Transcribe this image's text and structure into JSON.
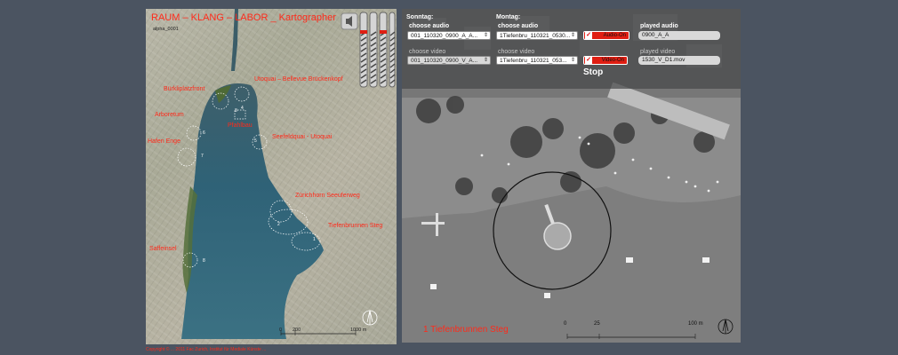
{
  "left": {
    "title": "RAUM – KLANG – LABOR _ Kartographer",
    "version": "alpha_0001",
    "places": [
      {
        "name": "Bürkliplatzfront"
      },
      {
        "name": "Utoquai – Bellevue Brückenkopf"
      },
      {
        "name": "Arboretum"
      },
      {
        "name": "Pfahlbau"
      },
      {
        "name": "Hafen Enge"
      },
      {
        "name": "Seefeldquai - Utoquai"
      },
      {
        "name": "Zürichhorn Seeuferweg"
      },
      {
        "name": "Tiefenbrunnen Steg"
      },
      {
        "name": "Saffeinsel"
      }
    ],
    "numbers": [
      "3",
      "4",
      "5",
      "6",
      "7",
      "2",
      "1",
      "8"
    ],
    "scale": {
      "zero": "0",
      "mid": "200",
      "end": "1000 m"
    },
    "credits": "Copyright © ... 2011 Fac Zurich, Institut für Mediale Künste ..."
  },
  "sliders": {
    "levels": [
      0.3,
      0.3,
      0.3,
      0.3
    ]
  },
  "controls": {
    "sonntag": "Sonntag:",
    "montag": "Montag:",
    "choose_audio": "choose audio",
    "choose_video": "choose video",
    "audio_sun": "001_110320_0900_A_A...",
    "video_sun": "001_110320_0900_V_A...",
    "audio_mon": "1Tiefenbru_110321_0530...",
    "video_mon": "1Tiefenbru_110321_053...",
    "audio_on": "Audio-On",
    "video_on": "Video-On",
    "played_audio_label": "played audio",
    "played_audio": "0900_A_A",
    "played_video_label": "played video",
    "played_video": "1530_V_D1.mov",
    "stop": "Stop"
  },
  "right": {
    "place_name": "1 Tiefenbrunnen Steg",
    "scale": {
      "zero": "0",
      "mid": "25",
      "end": "100 m"
    }
  }
}
